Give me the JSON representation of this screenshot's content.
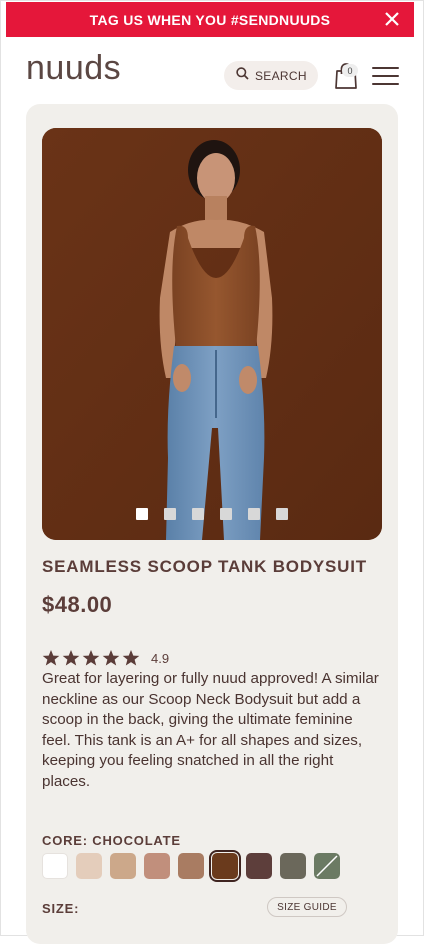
{
  "promo": {
    "text": "TAG US WHEN YOU #SENDNUUDS",
    "background": "#e5173a"
  },
  "header": {
    "logo": "nuuds",
    "search_label": "SEARCH",
    "cart_count": "0"
  },
  "product": {
    "image_alt": "Model wearing chocolate seamless scoop tank bodysuit with jeans",
    "carousel": {
      "slides": 6,
      "active_index": 0
    },
    "title": "SEAMLESS SCOOP TANK BODYSUIT",
    "price": "$48.00",
    "rating": {
      "value": "4.9",
      "stars": 5
    },
    "description": "Great for layering or fully nuud approved! A similar neckline as our Scoop Neck Bodysuit but add a scoop in the back, giving the ultimate feminine feel. This tank is an A+ for all shapes and sizes, keeping you feeling snatched in all the right places.",
    "color_label": "CORE: CHOCOLATE",
    "swatches": [
      {
        "color": "#ffffff",
        "selected": false
      },
      {
        "color": "#e4cdbb",
        "selected": false
      },
      {
        "color": "#cca88a",
        "selected": false
      },
      {
        "color": "#c18f7c",
        "selected": false
      },
      {
        "color": "#a97c62",
        "selected": false
      },
      {
        "color": "#6a3a1c",
        "selected": true
      },
      {
        "color": "#5d3e3b",
        "selected": false
      },
      {
        "color": "#6b685b",
        "selected": false
      },
      {
        "color": "#6b7a63",
        "selected": false,
        "crossed": true
      }
    ],
    "size_label": "SIZE:",
    "size_guide_label": "SIZE GUIDE"
  },
  "colors": {
    "brand_text": "#5b3d39",
    "card_bg": "#f1efeb",
    "accent": "#e5173a"
  }
}
